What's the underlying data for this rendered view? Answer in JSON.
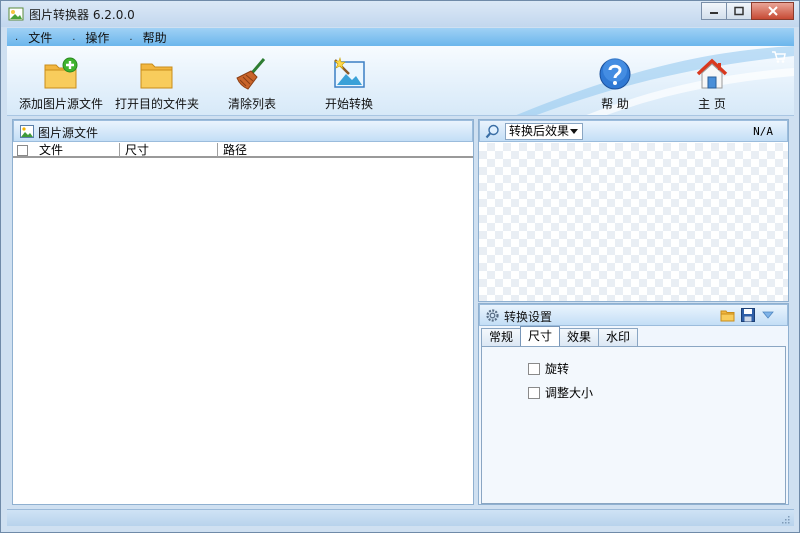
{
  "window": {
    "title": "图片转换器 6.2.0.0"
  },
  "menu": [
    {
      "label": "文件"
    },
    {
      "label": "操作"
    },
    {
      "label": "帮助"
    }
  ],
  "toolbar": {
    "add_source": "添加图片源文件",
    "open_folder": "打开目的文件夹",
    "clear_list": "清除列表",
    "start_convert": "开始转换",
    "help": "帮 助",
    "home": "主 页"
  },
  "source_panel": {
    "title": "图片源文件",
    "columns": [
      "文件",
      "尺寸",
      "路径"
    ]
  },
  "preview_panel": {
    "select_value": "转换后效果",
    "size_readout": "N/A"
  },
  "settings_panel": {
    "title": "转换设置",
    "tabs": [
      "常规",
      "尺寸",
      "效果",
      "水印"
    ],
    "active_tab": "尺寸",
    "options": [
      "旋转",
      "调整大小"
    ]
  },
  "colors": {
    "menu_bar": "#6cb6ec",
    "panel_border": "#8fb0d0",
    "close_button": "#c74a34"
  }
}
